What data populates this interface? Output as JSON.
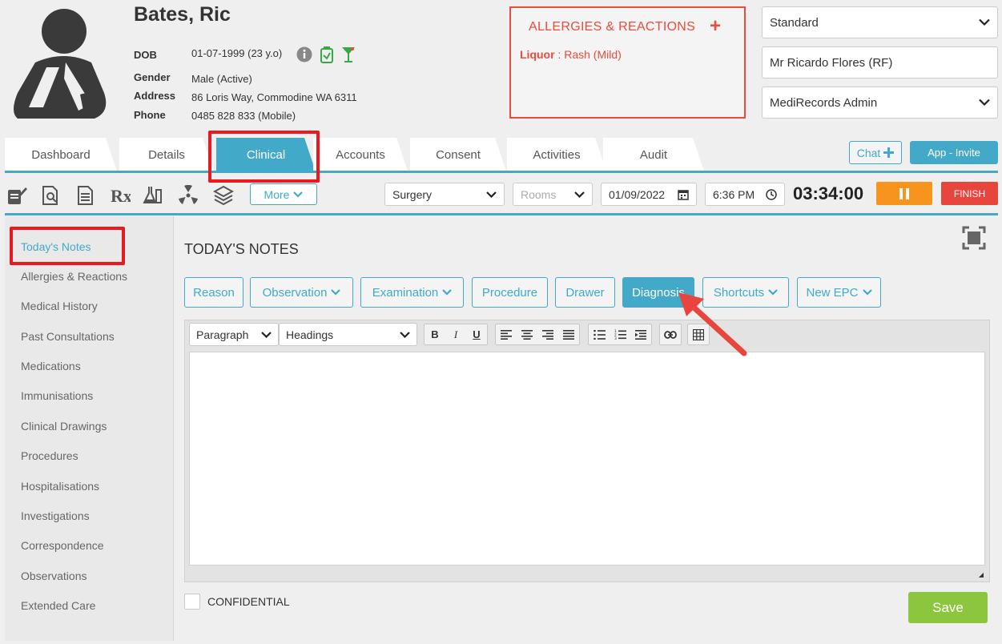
{
  "patient": {
    "name": "Bates, Ric",
    "dob_label": "DOB",
    "dob_value": "01-07-1999 (23 y.o)",
    "gender_label": "Gender",
    "gender_value": "Male (Active)",
    "address_label": "Address",
    "address_value": "86 Loris Way, Commodine WA 6311",
    "phone_label": "Phone",
    "phone_value": "0485 828 833 (Mobile)"
  },
  "allergies": {
    "title": "ALLERGIES & REACTIONS",
    "add_icon": "+",
    "item_name": "Liquor",
    "item_sep": " : ",
    "item_reaction": "Rash (Mild)"
  },
  "selects": {
    "template": "Standard",
    "practitioner": "Mr Ricardo Flores (RF)",
    "admin": "MediRecords Admin"
  },
  "tabs": [
    {
      "label": "Dashboard"
    },
    {
      "label": "Details"
    },
    {
      "label": "Clinical",
      "active": true
    },
    {
      "label": "Accounts"
    },
    {
      "label": "Consent"
    },
    {
      "label": "Activities"
    },
    {
      "label": "Audit"
    }
  ],
  "header_actions": {
    "chat_label": "Chat",
    "invite_label": "App - Invite"
  },
  "toolbar": {
    "icons": [
      "notes-pen-icon",
      "document-search-icon",
      "form-icon",
      "prescription-icon",
      "lab-flask-icon",
      "radiation-icon",
      "stack-icon"
    ],
    "more_label": "More",
    "location": "Surgery",
    "rooms_placeholder": "Rooms",
    "date": "01/09/2022",
    "time": "6:36 PM",
    "timer": "03:34:00",
    "finish_label": "FINISH"
  },
  "sidebar": {
    "items": [
      {
        "label": "Today's Notes",
        "active": true
      },
      {
        "label": "Allergies & Reactions"
      },
      {
        "label": "Medical History"
      },
      {
        "label": "Past Consultations"
      },
      {
        "label": "Medications"
      },
      {
        "label": "Immunisations"
      },
      {
        "label": "Clinical Drawings"
      },
      {
        "label": "Procedures"
      },
      {
        "label": "Hospitalisations"
      },
      {
        "label": "Investigations"
      },
      {
        "label": "Correspondence"
      },
      {
        "label": "Observations"
      },
      {
        "label": "Extended Care"
      }
    ]
  },
  "main": {
    "title": "TODAY'S NOTES",
    "note_buttons": [
      {
        "label": "Reason"
      },
      {
        "label": "Observation",
        "dropdown": true
      },
      {
        "label": "Examination",
        "dropdown": true
      },
      {
        "label": "Procedure"
      },
      {
        "label": "Drawer"
      },
      {
        "label": "Diagnosis",
        "active": true
      },
      {
        "label": "Shortcuts",
        "dropdown": true
      },
      {
        "label": "New EPC",
        "dropdown": true
      }
    ],
    "editor": {
      "paragraph": "Paragraph",
      "headings": "Headings",
      "bold": "B",
      "italic": "I",
      "underline": "U"
    },
    "confidential_label": "CONFIDENTIAL",
    "save_label": "Save"
  },
  "colors": {
    "accent": "#42a9c9",
    "allergy": "#e74c3c",
    "highlight": "#e8191f",
    "pause": "#f7941d",
    "finish": "#e8453c",
    "save": "#8cc63f"
  }
}
